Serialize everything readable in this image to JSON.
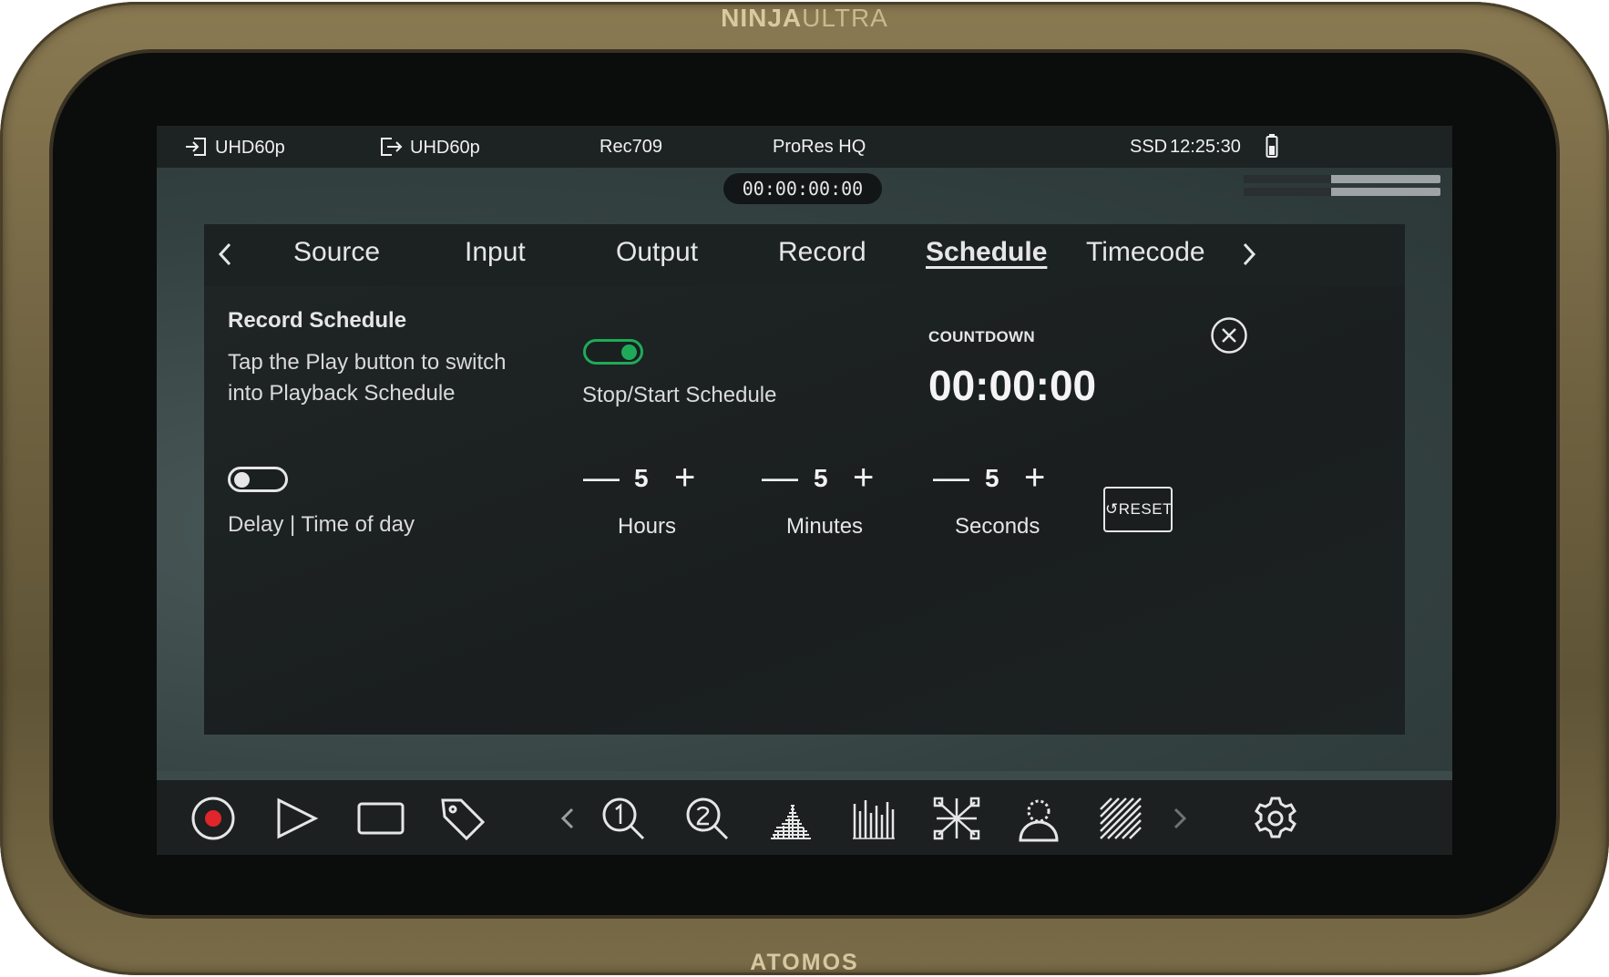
{
  "device": {
    "brand_top_bold": "NINJA",
    "brand_top_light": "ULTRA",
    "brand_bottom": "ATOMOS"
  },
  "status_bar": {
    "input_format": "UHD60p",
    "output_format": "UHD60p",
    "color_space": "Rec709",
    "codec": "ProRes HQ",
    "media": "SSD",
    "clock": "12:25:30",
    "icons": [
      "input-icon",
      "output-icon",
      "battery-icon"
    ]
  },
  "timecode": "00:00:00:00",
  "tabs": {
    "items": [
      "Source",
      "Input",
      "Output",
      "Record",
      "Schedule",
      "Timecode"
    ],
    "active": "Schedule",
    "icons": [
      "chevron-left-icon",
      "chevron-right-icon"
    ]
  },
  "schedule": {
    "title": "Record Schedule",
    "description_line1": "Tap the Play button to switch",
    "description_line2": "into Playback Schedule",
    "stop_start_label": "Stop/Start Schedule",
    "stop_start_enabled": true,
    "countdown_label": "COUNTDOWN",
    "countdown_value": "00:00:00",
    "delay_label": "Delay | Time of day",
    "delay_enabled": false,
    "hours_label": "Hours",
    "hours_value": "5",
    "minutes_label": "Minutes",
    "minutes_value": "5",
    "seconds_label": "Seconds",
    "seconds_value": "5",
    "minus_symbol": "—",
    "plus_symbol": "+",
    "reset_label": "RESET",
    "accent_color": "#1faa5a"
  },
  "toolbar": {
    "icons": [
      "record-icon",
      "play-icon",
      "monitor-icon",
      "tag-icon",
      "chevron-left-icon",
      "zoom-1-icon",
      "zoom-2-icon",
      "waveform-icon",
      "vectorscope-icon",
      "false-color-icon",
      "focus-peaking-icon",
      "zebra-icon",
      "chevron-right-icon",
      "settings-icon"
    ],
    "record_color": "#e0262b"
  }
}
